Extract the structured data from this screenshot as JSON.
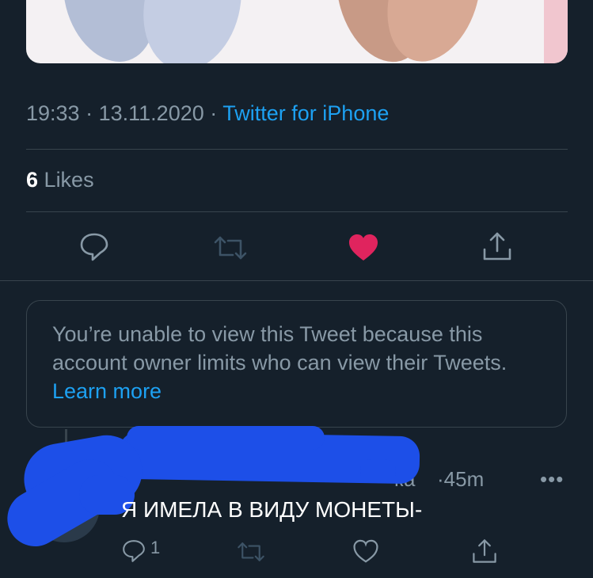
{
  "tweet": {
    "time": "19:33",
    "date": "13.11.2020",
    "separator": "·",
    "client": "Twitter for iPhone",
    "likes_count": "6",
    "likes_label": "Likes"
  },
  "actions": [
    "comment-icon",
    "retweet-icon",
    "like-icon-filled",
    "share-icon"
  ],
  "colors": {
    "background": "#15202b",
    "accent": "#1da1f2",
    "like": "#e0245e",
    "muted": "#8899a6",
    "redaction": "#1d4fe8"
  },
  "notice": {
    "text": "You’re unable to view this Tweet because this account owner limits who can view their Tweets.",
    "link": "Learn more"
  },
  "reply": {
    "handle_tail": "ка",
    "time": "·45m",
    "more": "•••",
    "text": "Я ИМЕЛА В ВИДУ МОНЕТЫ-",
    "reply_count": "1"
  }
}
